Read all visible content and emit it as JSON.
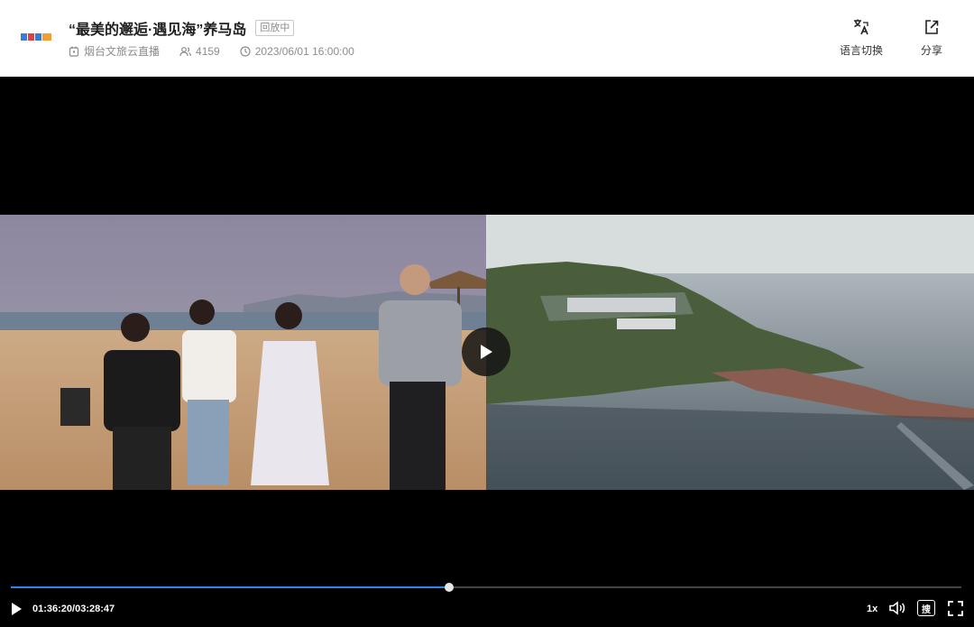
{
  "header": {
    "title": "“最美的邂逅·遇见海”养马岛",
    "status_badge": "回放中",
    "channel": "烟台文旅云直播",
    "viewers": "4159",
    "datetime": "2023/06/01 16:00:00",
    "actions": {
      "language": "语言切换",
      "share": "分享"
    }
  },
  "player": {
    "current_time": "01:36:20",
    "separator": "/",
    "duration": "03:28:47",
    "progress": 0.4613,
    "speed": "1x",
    "subtitle_icon_label": "搜"
  },
  "colors": {
    "progress": "#2a86f0",
    "accent_text": "#1f1f1f"
  }
}
